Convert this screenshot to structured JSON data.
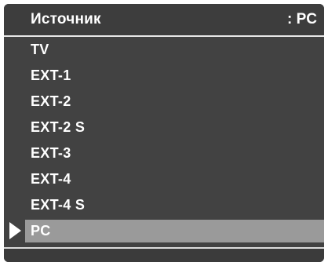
{
  "header": {
    "title": "Источник",
    "value": ": PC"
  },
  "menu": {
    "selected_index": 7,
    "items": [
      {
        "label": "TV"
      },
      {
        "label": "EXT-1"
      },
      {
        "label": "EXT-2"
      },
      {
        "label": "EXT-2 S"
      },
      {
        "label": "EXT-3"
      },
      {
        "label": "EXT-4"
      },
      {
        "label": "EXT-4 S"
      },
      {
        "label": "PC"
      }
    ]
  },
  "colors": {
    "background": "#424242",
    "highlight": "#9a9a9a",
    "text": "#ffffff",
    "divider": "#e8e8e8"
  },
  "icons": {
    "selection_pointer": "triangle-right-icon"
  }
}
